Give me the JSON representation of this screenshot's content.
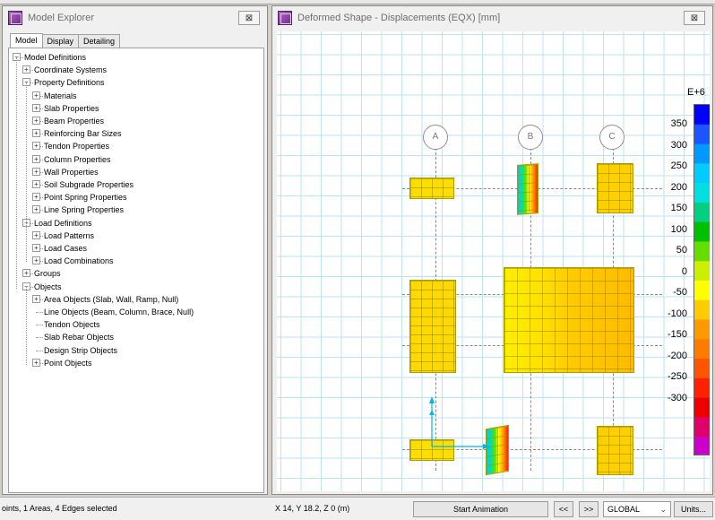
{
  "explorer": {
    "title": "Model Explorer",
    "close_glyph": "⊠",
    "tabs": [
      {
        "label": "Model"
      },
      {
        "label": "Display"
      },
      {
        "label": "Detailing"
      }
    ],
    "tree": [
      {
        "label": "Model Definitions",
        "expander": "−"
      },
      {
        "label": "Coordinate Systems",
        "expander": "+"
      },
      {
        "label": "Property Definitions",
        "expander": "−"
      },
      {
        "label": "Materials",
        "expander": "+"
      },
      {
        "label": "Slab Properties",
        "expander": "+"
      },
      {
        "label": "Beam Properties",
        "expander": "+"
      },
      {
        "label": "Reinforcing Bar Sizes",
        "expander": "+"
      },
      {
        "label": "Tendon Properties",
        "expander": "+"
      },
      {
        "label": "Column Properties",
        "expander": "+"
      },
      {
        "label": "Wall Properties",
        "expander": "+"
      },
      {
        "label": "Soil Subgrade Properties",
        "expander": "+"
      },
      {
        "label": "Point Spring Properties",
        "expander": "+"
      },
      {
        "label": "Line Spring Properties",
        "expander": "+"
      },
      {
        "label": "Load Definitions",
        "expander": "−"
      },
      {
        "label": "Load Patterns",
        "expander": "+"
      },
      {
        "label": "Load Cases",
        "expander": "+"
      },
      {
        "label": "Load Combinations",
        "expander": "+"
      },
      {
        "label": "Groups",
        "expander": "+"
      },
      {
        "label": "Objects",
        "expander": "−"
      },
      {
        "label": "Area Objects (Slab, Wall, Ramp, Null)",
        "expander": "+"
      },
      {
        "label": "Line Objects (Beam, Column, Brace, Null)",
        "expander": ""
      },
      {
        "label": "Tendon Objects",
        "expander": ""
      },
      {
        "label": "Slab Rebar Objects",
        "expander": ""
      },
      {
        "label": "Design Strip Objects",
        "expander": ""
      },
      {
        "label": "Point Objects",
        "expander": "+"
      }
    ]
  },
  "view": {
    "title": "Deformed Shape - Displacements (EQX)  [mm]",
    "close_glyph": "⊠",
    "grid_bubbles": [
      "A",
      "B",
      "C"
    ],
    "legend": {
      "exponent": "E+6",
      "labels": [
        "350",
        "300",
        "250",
        "200",
        "150",
        "100",
        "50",
        "0",
        "-50",
        "-100",
        "-150",
        "-200",
        "-250",
        "-300"
      ],
      "colors": [
        "#0000ff",
        "#1a55ff",
        "#0099ff",
        "#00ccff",
        "#00e0e0",
        "#00d080",
        "#00c000",
        "#66dd00",
        "#ccee00",
        "#ffff00",
        "#ffcc00",
        "#ff9900",
        "#ff7a00",
        "#ff5500",
        "#ff2200",
        "#ee0000",
        "#e0006a",
        "#cc00cc"
      ]
    }
  },
  "statusbar": {
    "selection": "oints, 1 Areas, 4 Edges selected",
    "coords": "X 14,  Y 18.2,  Z 0  (m)",
    "start_animation": "Start Animation",
    "prev": "<<",
    "next": ">>",
    "coord_system": "GLOBAL",
    "units": "Units..."
  }
}
